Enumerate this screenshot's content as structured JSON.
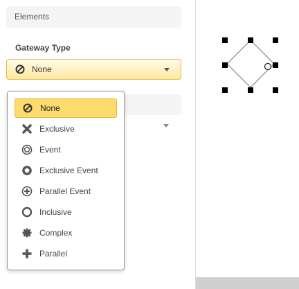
{
  "panel": {
    "section_title": "Elements",
    "gateway_label": "Gateway Type",
    "selected_value": "None"
  },
  "menu": {
    "items": [
      {
        "label": "None",
        "icon": "none-icon",
        "selected": true
      },
      {
        "label": "Exclusive",
        "icon": "exclusive-icon"
      },
      {
        "label": "Event",
        "icon": "event-icon"
      },
      {
        "label": "Exclusive Event",
        "icon": "exclusive-event-icon"
      },
      {
        "label": "Parallel Event",
        "icon": "parallel-event-icon"
      },
      {
        "label": "Inclusive",
        "icon": "inclusive-icon"
      },
      {
        "label": "Complex",
        "icon": "complex-icon"
      },
      {
        "label": "Parallel",
        "icon": "parallel-icon"
      }
    ]
  },
  "colors": {
    "selected_bg": "#fddb6e",
    "selected_border": "#e8b832",
    "icon": "#555555"
  }
}
